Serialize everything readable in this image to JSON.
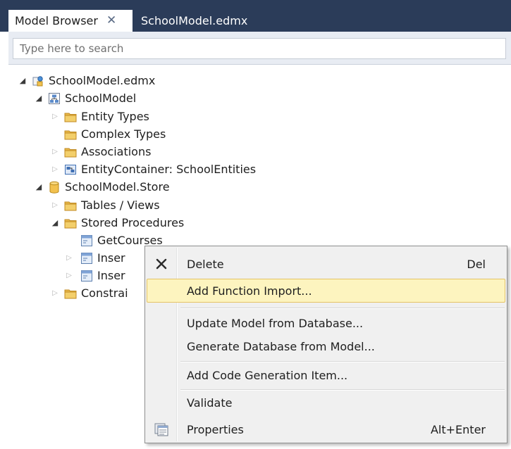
{
  "tabs": {
    "active_label": "Model Browser",
    "close_glyph": "✕",
    "inactive_label": "SchoolModel.edmx"
  },
  "search": {
    "placeholder": "Type here to search"
  },
  "tree": {
    "root": "SchoolModel.edmx",
    "conceptual_model": "SchoolModel",
    "entity_types": "Entity Types",
    "complex_types": "Complex Types",
    "associations": "Associations",
    "entity_container": "EntityContainer: SchoolEntities",
    "store": "SchoolModel.Store",
    "tables_views": "Tables / Views",
    "stored_procedures": "Stored Procedures",
    "proc_get_courses": "GetCourses",
    "proc_insert_1": "Inser",
    "proc_insert_2": "Inser",
    "constraints": "Constrai"
  },
  "context_menu": {
    "delete": {
      "label": "Delete",
      "shortcut": "Del",
      "icon": "delete-x-icon"
    },
    "add_function_import": {
      "label": "Add Function Import..."
    },
    "update_model": {
      "label": "Update Model from Database..."
    },
    "generate_database": {
      "label": "Generate Database from Model..."
    },
    "add_code_generation": {
      "label": "Add Code Generation Item..."
    },
    "validate": {
      "label": "Validate"
    },
    "properties": {
      "label": "Properties",
      "shortcut": "Alt+Enter",
      "icon": "properties-icon"
    }
  },
  "colors": {
    "tabbar": "#2b3c59",
    "menu_highlight": "#fdf4bf",
    "menu_highlight_border": "#e5c365",
    "folder": "#e8b84a"
  }
}
